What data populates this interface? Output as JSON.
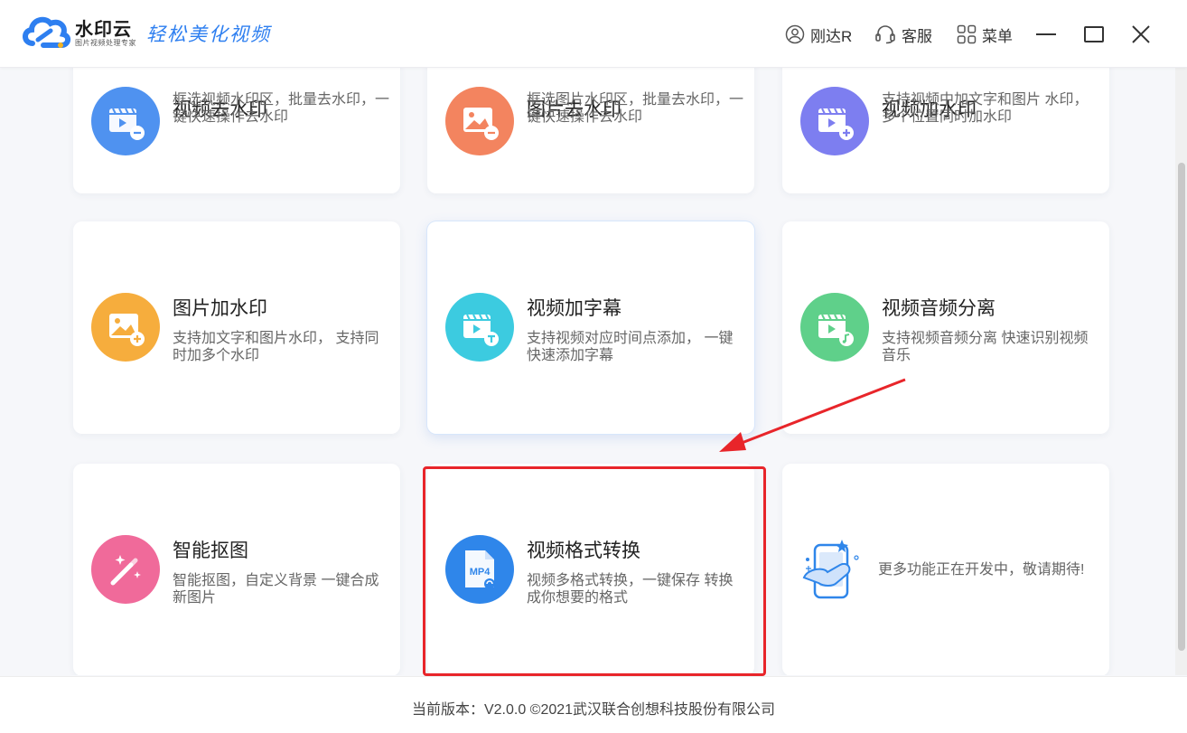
{
  "header": {
    "brand_name": "水印云",
    "brand_sub": "图片视频处理专家",
    "slogan": "轻松美化视频",
    "user": "刚达R",
    "service": "客服",
    "menu": "菜单"
  },
  "cards": [
    {
      "title": "视频去水印",
      "desc": "框选视频水印区，批量去水印，一键快速操作去水印"
    },
    {
      "title": "图片去水印",
      "desc": "框选图片水印区，批量去水印，一键快速操作去水印"
    },
    {
      "title": "视频加水印",
      "desc": "支持视频中加文字和图片 水印，多个位置同时加水印"
    },
    {
      "title": "图片加水印",
      "desc": "支持加文字和图片水印， 支持同时加多个水印"
    },
    {
      "title": "视频加字幕",
      "desc": "支持视频对应时间点添加， 一键快速添加字幕"
    },
    {
      "title": "视频音频分离",
      "desc": "支持视频音频分离 快速识别视频音乐"
    },
    {
      "title": "智能抠图",
      "desc": "智能抠图，自定义背景 一键合成新图片"
    },
    {
      "title": "视频格式转换",
      "desc": "视频多格式转换，一键保存 转换成你想要的格式"
    },
    {
      "title": "",
      "desc": "更多功能正在开发中，敬请期待!"
    }
  ],
  "icon_badges": {
    "mp4": "MP4"
  },
  "footer": {
    "text": "当前版本：V2.0.0 ©2021武汉联合创想科技股份有限公司"
  },
  "colors": {
    "accent": "#2e7ff0",
    "video_remove": "#4f92f0",
    "image_remove": "#f3845f",
    "video_watermark": "#7d7ef0",
    "image_watermark": "#f6ad3d",
    "subtitle": "#3ccbe0",
    "audio_split": "#5fd08a",
    "cutout": "#f06a9a",
    "convert": "#2f86ea",
    "highlight": "#e8252a"
  }
}
